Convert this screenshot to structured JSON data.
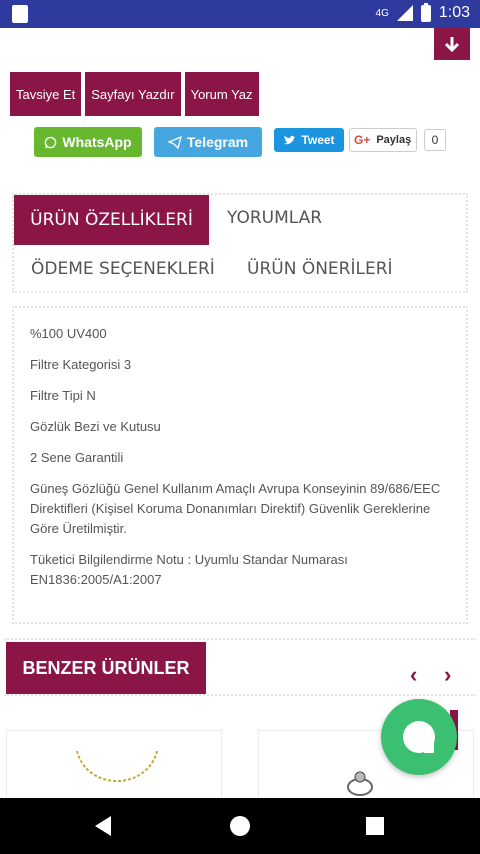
{
  "status_bar": {
    "network": "4G",
    "time": "1:03"
  },
  "actions": {
    "recommend": "Tavsiye Et",
    "print": "Sayfayı Yazdır",
    "comment": "Yorum Yaz"
  },
  "share": {
    "whatsapp": "WhatsApp",
    "telegram": "Telegram",
    "tweet": "Tweet",
    "share_label": "Paylaş",
    "share_count": "0"
  },
  "tabs": {
    "features": "ÜRÜN ÖZELLİKLERİ",
    "reviews": "YORUMLAR",
    "payment": "ÖDEME SEÇENEKLERİ",
    "suggestions": "ÜRÜN ÖNERİLERİ"
  },
  "details": [
    "%100 UV400",
    "Filtre Kategorisi 3",
    "Filtre Tipi N",
    "Gözlük Bezi ve Kutusu",
    "2 Sene Garantili",
    "Güneş Gözlüğü Genel Kullanım Amaçlı Avrupa Konseyinin 89/686/EEC Direktifleri (Kişisel Koruma Donanımları Direktif) Güvenlik Gereklerine Göre Üretilmiştir.",
    "Tüketici Bilgilendirme Notu : Uyumlu Standar Numarası EN1836:2005/A1:2007"
  ],
  "related": {
    "title": "BENZER ÜRÜNLER",
    "prev": "‹",
    "next": "›"
  },
  "colors": {
    "brand": "#8b1547",
    "whatsapp": "#67b72f",
    "telegram": "#45a6e0",
    "twitter": "#1b95e0",
    "chat": "#3bbf71"
  },
  "icons": [
    "sd-card-icon",
    "signal-icon",
    "battery-icon",
    "arrow-down-icon",
    "whatsapp-icon",
    "telegram-icon",
    "twitter-icon",
    "google-plus-icon",
    "chat-icon",
    "back-icon",
    "home-icon",
    "recents-icon"
  ]
}
